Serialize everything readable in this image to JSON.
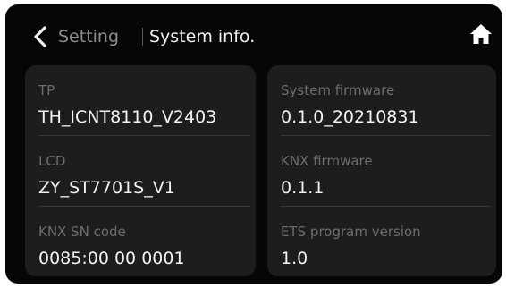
{
  "header": {
    "back_icon": "chevron-left-icon",
    "parent_label": "Setting",
    "title": "System info.",
    "home_icon": "home-icon"
  },
  "cards": {
    "left": [
      {
        "label": "TP",
        "value": "TH_ICNT8110_V2403"
      },
      {
        "label": "LCD",
        "value": "ZY_ST7701S_V1"
      },
      {
        "label": "KNX SN code",
        "value": "0085:00 00 0001"
      }
    ],
    "right": [
      {
        "label": "System firmware",
        "value": "0.1.0_20210831"
      },
      {
        "label": "KNX firmware",
        "value": "0.1.1"
      },
      {
        "label": "ETS program version",
        "value": "1.0"
      }
    ]
  },
  "colors": {
    "panel_background": "#060606",
    "card_background": "#1d1d1d",
    "label_text": "#6c6c6c",
    "value_text": "#f3f3f3",
    "parent_text": "#8d8d8d"
  }
}
